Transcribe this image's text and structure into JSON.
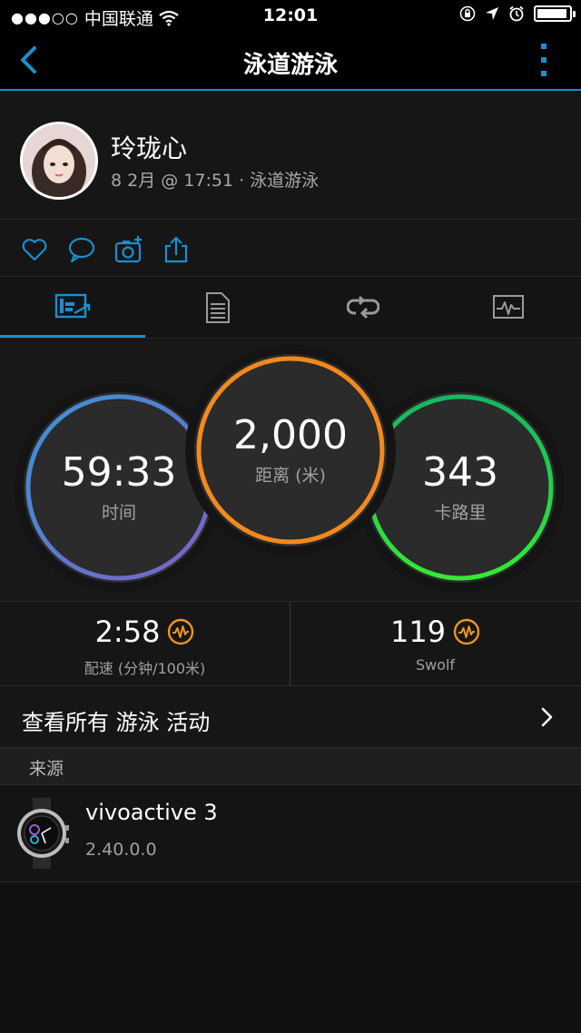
{
  "status_bar": {
    "signal": "●●●○○",
    "carrier": "中国联通",
    "time": "12:01",
    "battery_level": 0.95
  },
  "nav": {
    "title": "泳道游泳",
    "accent_color": "#1a8fd0"
  },
  "activity": {
    "user_name": "玲珑心",
    "meta": "8 2月 @ 17:51 · 泳道游泳"
  },
  "actions": [
    "heart-icon",
    "comment-icon",
    "add-photo-icon",
    "share-icon"
  ],
  "tabs": [
    "summary-tab-icon",
    "details-tab-icon",
    "laps-tab-icon",
    "charts-tab-icon"
  ],
  "rings": {
    "time": {
      "value": "59:33",
      "label": "时间",
      "colors": [
        "#3b93d9",
        "#7b62c2"
      ]
    },
    "distance": {
      "value": "2,000",
      "label": "距离 (米)",
      "color": "#f28a1d"
    },
    "calories": {
      "value": "343",
      "label": "卡路里",
      "colors": [
        "#14c85c",
        "#2fe53a"
      ]
    }
  },
  "stats": {
    "pace": {
      "value": "2:58",
      "label": "配速 (分钟/100米)"
    },
    "swolf": {
      "value": "119",
      "label": "Swolf"
    },
    "badge_color": "#f0961e"
  },
  "view_all": {
    "label": "查看所有 游泳 活动"
  },
  "source": {
    "header": "来源",
    "device_name": "vivoactive 3",
    "device_version": "2.40.0.0"
  }
}
